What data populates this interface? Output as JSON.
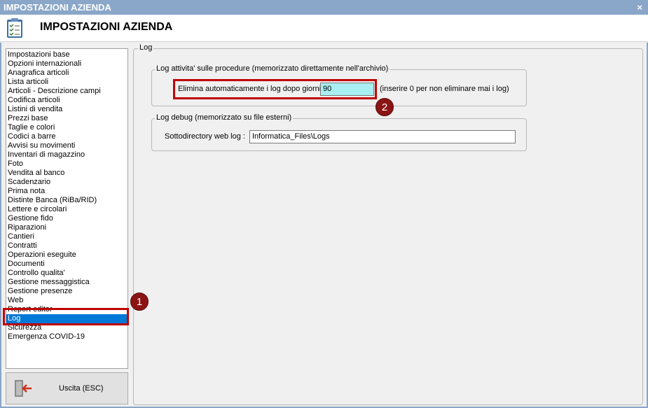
{
  "window": {
    "title": "IMPOSTAZIONI AZIENDA",
    "close_glyph": "×"
  },
  "header": {
    "title": "IMPOSTAZIONI AZIENDA",
    "icon": "clipboard-checklist-icon"
  },
  "sidebar": {
    "items": [
      {
        "label": "Impostazioni base"
      },
      {
        "label": "Opzioni internazionali"
      },
      {
        "label": "Anagrafica articoli"
      },
      {
        "label": "Lista articoli"
      },
      {
        "label": "Articoli - Descrizione campi"
      },
      {
        "label": "Codifica articoli"
      },
      {
        "label": "Listini di vendita"
      },
      {
        "label": "Prezzi base"
      },
      {
        "label": "Taglie e colori"
      },
      {
        "label": "Codici a barre"
      },
      {
        "label": "Avvisi su movimenti"
      },
      {
        "label": "Inventari di magazzino"
      },
      {
        "label": "Foto"
      },
      {
        "label": "Vendita al banco"
      },
      {
        "label": "Scadenzario"
      },
      {
        "label": "Prima nota"
      },
      {
        "label": "Distinte Banca (RiBa/RID)"
      },
      {
        "label": "Lettere e circolari"
      },
      {
        "label": "Gestione fido"
      },
      {
        "label": "Riparazioni"
      },
      {
        "label": "Cantieri"
      },
      {
        "label": "Contratti"
      },
      {
        "label": "Operazioni eseguite"
      },
      {
        "label": "Documenti"
      },
      {
        "label": "Controllo qualita'"
      },
      {
        "label": "Gestione messaggistica"
      },
      {
        "label": "Gestione presenze"
      },
      {
        "label": "Web"
      },
      {
        "label": "Report editor"
      },
      {
        "label": "Log"
      },
      {
        "label": "Sicurezza"
      },
      {
        "label": "Emergenza COVID-19"
      }
    ],
    "selected": "Log"
  },
  "exit_button": {
    "label": "Uscita (ESC)",
    "icon": "exit-door-icon"
  },
  "panel": {
    "legend": "Log",
    "activity_group": {
      "legend": "Log attivita' sulle procedure (memorizzato direttamente nell'archivio)",
      "field_label": "Elimina automaticamente i log dopo giorni",
      "value": "90",
      "hint": "(inserire 0 per non eliminare mai i log)"
    },
    "debug_group": {
      "legend": "Log debug (memorizzato su file esterni)",
      "field_label": "Sottodirectory web log :",
      "value": "Informatica_Files\\Logs"
    }
  },
  "annotations": {
    "badge1": "1",
    "badge2": "2"
  },
  "colors": {
    "titlebar": "#8aa6c8",
    "selection": "#0078d7",
    "highlight_input": "#a8eef2",
    "annotation_red": "#c00000",
    "badge": "#8b1414"
  }
}
